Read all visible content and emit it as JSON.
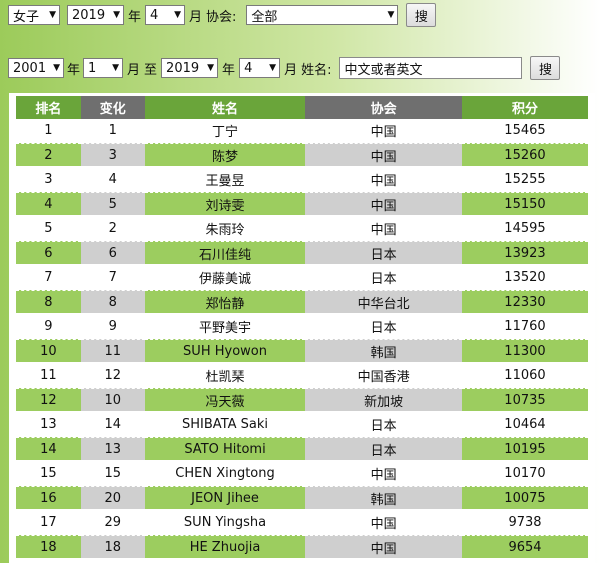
{
  "filters_row1": {
    "gender": "女子",
    "year": "2019",
    "year_unit": "年",
    "month": "4",
    "month_unit": "月",
    "assoc_label": "协会:",
    "assoc": "全部",
    "search_label": "搜"
  },
  "filters_row2": {
    "from_year": "2001",
    "from_year_unit": "年",
    "from_month": "1",
    "from_month_unit": "月",
    "to_label": "至",
    "to_year": "2019",
    "to_year_unit": "年",
    "to_month": "4",
    "to_month_unit": "月",
    "name_label": "姓名:",
    "name_value": "中文或者英文",
    "search_label": "搜"
  },
  "table": {
    "headers": [
      "排名",
      "变化",
      "姓名",
      "协会",
      "积分"
    ],
    "rows": [
      [
        "1",
        "1",
        "丁宁",
        "中国",
        "15465"
      ],
      [
        "2",
        "3",
        "陈梦",
        "中国",
        "15260"
      ],
      [
        "3",
        "4",
        "王曼昱",
        "中国",
        "15255"
      ],
      [
        "4",
        "5",
        "刘诗雯",
        "中国",
        "15150"
      ],
      [
        "5",
        "2",
        "朱雨玲",
        "中国",
        "14595"
      ],
      [
        "6",
        "6",
        "石川佳纯",
        "日本",
        "13923"
      ],
      [
        "7",
        "7",
        "伊藤美诚",
        "日本",
        "13520"
      ],
      [
        "8",
        "8",
        "郑怡静",
        "中华台北",
        "12330"
      ],
      [
        "9",
        "9",
        "平野美宇",
        "日本",
        "11760"
      ],
      [
        "10",
        "11",
        "SUH Hyowon",
        "韩国",
        "11300"
      ],
      [
        "11",
        "12",
        "杜凯琹",
        "中国香港",
        "11060"
      ],
      [
        "12",
        "10",
        "冯天薇",
        "新加坡",
        "10735"
      ],
      [
        "13",
        "14",
        "SHIBATA Saki",
        "日本",
        "10464"
      ],
      [
        "14",
        "13",
        "SATO Hitomi",
        "日本",
        "10195"
      ],
      [
        "15",
        "15",
        "CHEN Xingtong",
        "中国",
        "10170"
      ],
      [
        "16",
        "20",
        "JEON Jihee",
        "韩国",
        "10075"
      ],
      [
        "17",
        "29",
        "SUN Yingsha",
        "中国",
        "9738"
      ],
      [
        "18",
        "18",
        "HE Zhuojia",
        "中国",
        "9654"
      ]
    ]
  },
  "colors": {
    "header_green": "#6aa53a",
    "header_gray": "#6f6f6f",
    "row_green": "#9ccd5f",
    "row_gray": "#cfcfcf"
  }
}
